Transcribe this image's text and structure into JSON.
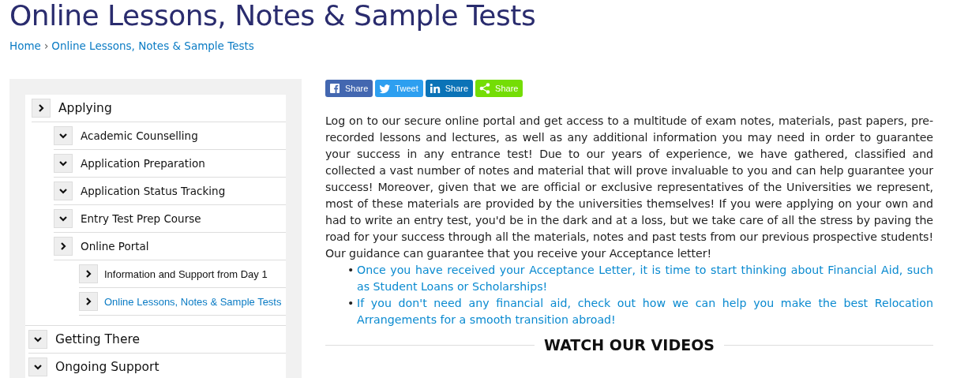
{
  "page_title": "Online Lessons, Notes & Sample Tests",
  "breadcrumb": {
    "items": [
      "Home",
      "Online Lessons, Notes & Sample Tests"
    ],
    "separator": "›"
  },
  "sidebar": {
    "items": [
      {
        "label": "Applying",
        "arrow_down": false,
        "selected": false,
        "children": [
          {
            "label": "Academic Counselling",
            "arrow_down": true,
            "selected": false
          },
          {
            "label": "Application Preparation",
            "arrow_down": true,
            "selected": false
          },
          {
            "label": "Application Status Tracking",
            "arrow_down": true,
            "selected": false
          },
          {
            "label": "Entry Test Prep Course",
            "arrow_down": true,
            "selected": false
          },
          {
            "label": "Online Portal",
            "arrow_down": false,
            "selected": false,
            "children": [
              {
                "label": "Information and Support from Day 1",
                "arrow_down": false,
                "selected": false
              },
              {
                "label": "Online Lessons, Notes & Sample Tests",
                "arrow_down": false,
                "selected": true
              }
            ]
          }
        ]
      },
      {
        "label": "Getting There",
        "arrow_down": true,
        "selected": false
      },
      {
        "label": "Ongoing Support",
        "arrow_down": true,
        "selected": false
      }
    ]
  },
  "share_buttons": [
    {
      "kind": "facebook",
      "label": "Share",
      "color": "#4367b0"
    },
    {
      "kind": "twitter",
      "label": "Tweet",
      "color": "#2d9ff0"
    },
    {
      "kind": "linkedin",
      "label": "Share",
      "color": "#0b73b7"
    },
    {
      "kind": "share",
      "label": "Share",
      "color": "#74dd05"
    }
  ],
  "article": {
    "paragraph": "Log on to our secure online portal and get access to a multitude of exam notes, materials, past papers, pre-recorded lessons and lectures, as well as any additional information you may need in order to guarantee your success in any entrance test! Due to our years of experience, we have gathered, classified and collected a vast number of notes and material that will prove invaluable to you and can help guarantee your success! Moreover, given that we are official or exclusive representatives of the Universities we represent, most of these materials are provided by the universities themselves! If you were applying on your own and had to write an entry test, you'd be in the dark and at a loss, but we take care of all the stress by paving the road for your success through all the materials, notes and past tests from our previous prospective students! Our guidance can guarantee that you receive your Acceptance letter!",
    "links": [
      {
        "bullet": "•",
        "text": "Once you have received your Acceptance Letter, it is time to start thinking about Financial Aid, such as Student Loans or Scholarships!"
      },
      {
        "bullet": "•",
        "text": "If you don't need any financial aid, check out how we can help you make the best Relocation Arrangements for a smooth transition abroad!"
      }
    ]
  },
  "section_heading": "WATCH OUR VIDEOS"
}
